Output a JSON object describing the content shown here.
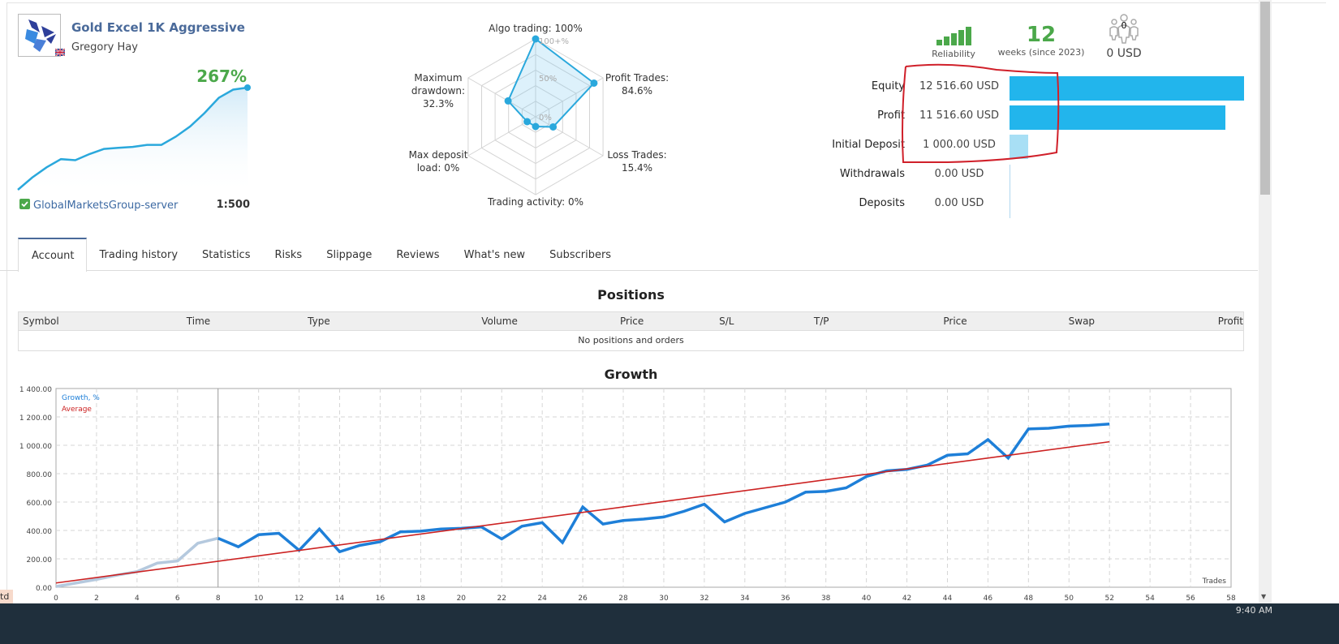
{
  "header": {
    "title": "Gold Excel 1K Aggressive",
    "author": "Gregory Hay",
    "country_flag": "uk-flag-icon",
    "growth_percent": "267%",
    "server": "GlobalMarketsGroup-server",
    "leverage": "1:500",
    "mini_growth_trend": [
      0,
      12,
      22,
      30,
      29,
      35,
      40,
      41,
      42,
      44,
      44,
      52,
      62,
      75,
      90,
      98,
      100
    ]
  },
  "radar": {
    "labels": {
      "algo": "Algo trading: 100%",
      "profit": [
        "Profit Trades:",
        "84.6%"
      ],
      "loss": [
        "Loss Trades:",
        "15.4%"
      ],
      "activity": "Trading activity: 0%",
      "deposit_load": [
        "Max deposit",
        "load: 0%"
      ],
      "drawdown": [
        "Maximum",
        "drawdown:",
        "32.3%"
      ]
    },
    "scale_labels": [
      "100+%",
      "50%",
      "0%"
    ],
    "values": {
      "algo_trading": 100,
      "profit_trades": 84.6,
      "loss_trades": 15.4,
      "trading_activity": 0,
      "max_deposit_load": 0,
      "max_drawdown": 32.3
    }
  },
  "stats": {
    "reliability_label": "Reliability",
    "reliability_level": 5,
    "weeks_value": "12",
    "weeks_label": "weeks (since 2023)",
    "subscribers_count": "0",
    "subscribers_funds": "0 USD"
  },
  "financials": [
    {
      "label": "Equity",
      "value": "12 516.60 USD",
      "amount": 12516.6,
      "color": "#22b5ec"
    },
    {
      "label": "Profit",
      "value": "11 516.60 USD",
      "amount": 11516.6,
      "color": "#22b5ec"
    },
    {
      "label": "Initial Deposit",
      "value": "1 000.00 USD",
      "amount": 1000.0,
      "color": "#a8dff5"
    },
    {
      "label": "Withdrawals",
      "value": "0.00 USD",
      "amount": 0,
      "color": "#22b5ec"
    },
    {
      "label": "Deposits",
      "value": "0.00 USD",
      "amount": 0,
      "color": "#22b5ec"
    }
  ],
  "tabs": [
    {
      "label": "Account",
      "active": true
    },
    {
      "label": "Trading history",
      "active": false
    },
    {
      "label": "Statistics",
      "active": false
    },
    {
      "label": "Risks",
      "active": false
    },
    {
      "label": "Slippage",
      "active": false
    },
    {
      "label": "Reviews",
      "active": false
    },
    {
      "label": "What's new",
      "active": false
    },
    {
      "label": "Subscribers",
      "active": false
    }
  ],
  "positions": {
    "title": "Positions",
    "columns": [
      "Symbol",
      "Time",
      "Type",
      "Volume",
      "Price",
      "S/L",
      "T/P",
      "Price",
      "Swap",
      "Profit"
    ],
    "empty_message": "No positions and orders"
  },
  "chart_data": {
    "type": "line",
    "title": "Growth",
    "xlabel": "Trades",
    "ylabel": "",
    "xlim": [
      0,
      58
    ],
    "ylim": [
      0,
      1400
    ],
    "x_ticks": [
      0,
      2,
      4,
      6,
      8,
      10,
      12,
      14,
      16,
      18,
      20,
      22,
      24,
      26,
      28,
      30,
      32,
      34,
      36,
      38,
      40,
      42,
      44,
      46,
      48,
      50,
      52,
      54,
      56,
      58
    ],
    "y_ticks": [
      "0.00",
      "200.00",
      "400.00",
      "600.00",
      "800.00",
      "1 000.00",
      "1 200.00",
      "1 400.00"
    ],
    "grid": true,
    "legend_position": "top-left",
    "marker_x": 8,
    "series": [
      {
        "name": "Growth, %",
        "color": "#1e7fd8",
        "faded_until": 8,
        "faded_color": "#b5c9de",
        "x": [
          0,
          1,
          2,
          3,
          4,
          5,
          6,
          7,
          8,
          9,
          10,
          11,
          12,
          13,
          14,
          15,
          16,
          17,
          18,
          19,
          20,
          21,
          22,
          23,
          24,
          25,
          26,
          27,
          28,
          29,
          30,
          31,
          32,
          33,
          34,
          35,
          36,
          37,
          38,
          39,
          40,
          41,
          42,
          43,
          44,
          45,
          46,
          47,
          48,
          49,
          50,
          51,
          52
        ],
        "values": [
          5,
          30,
          55,
          85,
          110,
          170,
          185,
          310,
          345,
          285,
          370,
          380,
          260,
          410,
          250,
          295,
          320,
          390,
          395,
          410,
          415,
          425,
          340,
          430,
          455,
          315,
          565,
          445,
          470,
          480,
          495,
          535,
          585,
          460,
          520,
          560,
          600,
          670,
          675,
          700,
          780,
          820,
          830,
          860,
          930,
          940,
          1040,
          910,
          1115,
          1120,
          1135,
          1140,
          1150
        ]
      },
      {
        "name": "Average",
        "color": "#cc2222",
        "x": [
          0,
          52
        ],
        "values": [
          30,
          1025
        ]
      }
    ]
  },
  "taskbar": {
    "clock": "9:40 AM",
    "left_tag": "td"
  }
}
